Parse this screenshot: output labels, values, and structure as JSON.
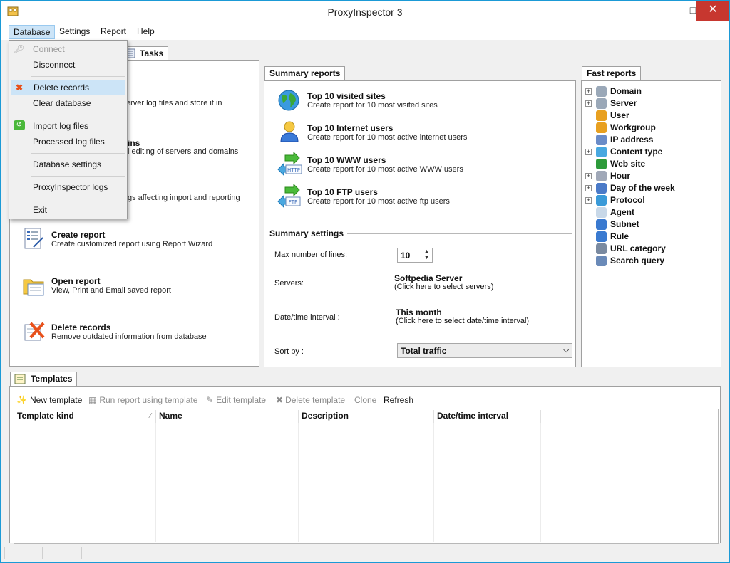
{
  "window": {
    "title": "ProxyInspector 3"
  },
  "menubar": {
    "items": [
      "Database",
      "Settings",
      "Report",
      "Help"
    ]
  },
  "database_menu": {
    "items": [
      "Connect",
      "Disconnect",
      "Delete records",
      "Clear database",
      "Import log files",
      "Processed log files",
      "Database settings",
      "ProxyInspector logs",
      "Exit"
    ]
  },
  "tasks_panel": {
    "tab_label": "Tasks",
    "partial_texts": [
      "erver log files and store it in",
      "ins",
      "l editing of servers and domains",
      "gs affecting import and reporting"
    ],
    "items": [
      {
        "title": "Create report",
        "desc": "Create customized report using Report Wizard"
      },
      {
        "title": "Open report",
        "desc": "View, Print and Email saved report"
      },
      {
        "title": "Delete records",
        "desc": "Remove outdated information from database"
      }
    ]
  },
  "summary_reports": {
    "tab_label": "Summary reports",
    "items": [
      {
        "title": "Top 10 visited sites",
        "desc": "Create report for  10 most visited sites"
      },
      {
        "title": "Top 10 Internet users",
        "desc": "Create report for  10 most active internet users"
      },
      {
        "title": "Top 10 WWW users",
        "desc": "Create report for  10 most active WWW users"
      },
      {
        "title": "Top 10 FTP users",
        "desc": "Create report for  10 most active ftp users"
      }
    ],
    "http_badge": "HTTP",
    "ftp_badge": "FTP"
  },
  "summary_settings": {
    "header": "Summary settings",
    "max_lines_label": "Max number of lines:",
    "max_lines_value": "10",
    "servers_label": "Servers:",
    "servers_value": "Softpedia Server",
    "servers_hint": "(Click here to select servers)",
    "interval_label": "Date/time interval :",
    "interval_value": "This month",
    "interval_hint": "(Click here to select date/time interval)",
    "sortby_label": "Sort by :",
    "sortby_value": "Total traffic"
  },
  "fast_reports": {
    "tab_label": "Fast reports",
    "items": [
      {
        "label": "Domain",
        "expandable": true,
        "color": "#9aa8b8"
      },
      {
        "label": "Server",
        "expandable": true,
        "color": "#9aa8b8"
      },
      {
        "label": "User",
        "expandable": false,
        "color": "#e8a020"
      },
      {
        "label": "Workgroup",
        "expandable": false,
        "color": "#e8a020"
      },
      {
        "label": "IP address",
        "expandable": false,
        "color": "#6a8cc8"
      },
      {
        "label": "Content type",
        "expandable": true,
        "color": "#48a8e0"
      },
      {
        "label": "Web site",
        "expandable": false,
        "color": "#2d9a3a"
      },
      {
        "label": "Hour",
        "expandable": true,
        "color": "#a0a8b8"
      },
      {
        "label": "Day of the week",
        "expandable": true,
        "color": "#4a7ac8"
      },
      {
        "label": "Protocol",
        "expandable": true,
        "color": "#3a9ad8"
      },
      {
        "label": "Agent",
        "expandable": false,
        "color": "#c8d8e8"
      },
      {
        "label": "Subnet",
        "expandable": false,
        "color": "#3a7ad0"
      },
      {
        "label": "Rule",
        "expandable": false,
        "color": "#3a7ad0"
      },
      {
        "label": "URL category",
        "expandable": false,
        "color": "#7a8aa0"
      },
      {
        "label": "Search query",
        "expandable": false,
        "color": "#6a8ab8"
      }
    ]
  },
  "templates": {
    "tab_label": "Templates",
    "toolbar": {
      "new": "New template",
      "run": "Run report using template",
      "edit": "Edit template",
      "delete": "Delete template",
      "clone": "Clone",
      "refresh": "Refresh"
    },
    "columns": [
      "Template kind",
      "Name",
      "Description",
      "Date/time interval"
    ]
  }
}
